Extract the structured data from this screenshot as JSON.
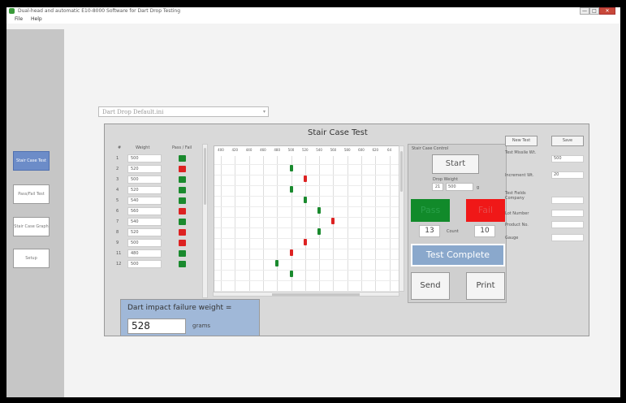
{
  "window": {
    "title": "Dual-head and automatic E10-8000 Software for Dart Drop Testing",
    "controls": {
      "minimize": "—",
      "maximize": "□",
      "close": "✕"
    }
  },
  "menu": [
    "File",
    "Help"
  ],
  "sidebar": {
    "items": [
      {
        "label": "Stair Case Test",
        "active": true
      },
      {
        "label": "Pass/Fail Test",
        "active": false
      },
      {
        "label": "Stair Case Graph",
        "active": false
      },
      {
        "label": "Setup",
        "active": false
      }
    ]
  },
  "profile_select": {
    "value": "Dart Drop Default.ini",
    "arrow": "▾"
  },
  "panel": {
    "title": "Stair Case Test"
  },
  "table": {
    "headers": {
      "num": "#",
      "weight": "Weight",
      "pf": "Pass / Fail"
    },
    "rows": [
      {
        "num": "1",
        "weight": "500",
        "pass": true
      },
      {
        "num": "2",
        "weight": "520",
        "pass": false
      },
      {
        "num": "3",
        "weight": "500",
        "pass": true
      },
      {
        "num": "4",
        "weight": "520",
        "pass": true
      },
      {
        "num": "5",
        "weight": "540",
        "pass": true
      },
      {
        "num": "6",
        "weight": "560",
        "pass": false
      },
      {
        "num": "7",
        "weight": "540",
        "pass": true
      },
      {
        "num": "8",
        "weight": "520",
        "pass": false
      },
      {
        "num": "9",
        "weight": "500",
        "pass": false
      },
      {
        "num": "11",
        "weight": "480",
        "pass": true
      },
      {
        "num": "12",
        "weight": "500",
        "pass": true
      }
    ]
  },
  "chart_data": {
    "type": "scatter",
    "x_ticks": [
      "400",
      "420",
      "440",
      "460",
      "480",
      "500",
      "520",
      "540",
      "560",
      "580",
      "600",
      "620",
      "64"
    ],
    "xlim": [
      400,
      640
    ],
    "points": [
      {
        "x": 500,
        "row": 1,
        "pass": true
      },
      {
        "x": 520,
        "row": 2,
        "pass": false
      },
      {
        "x": 500,
        "row": 3,
        "pass": true
      },
      {
        "x": 520,
        "row": 4,
        "pass": true
      },
      {
        "x": 540,
        "row": 5,
        "pass": true
      },
      {
        "x": 560,
        "row": 6,
        "pass": false
      },
      {
        "x": 540,
        "row": 7,
        "pass": true
      },
      {
        "x": 520,
        "row": 8,
        "pass": false
      },
      {
        "x": 500,
        "row": 9,
        "pass": false
      },
      {
        "x": 480,
        "row": 10,
        "pass": true
      },
      {
        "x": 500,
        "row": 11,
        "pass": true
      }
    ]
  },
  "controls": {
    "label": "Stair Case Control",
    "start": "Start",
    "drop_weight_label": "Drop Weight",
    "drop_weight_a": "21",
    "drop_weight_b": "500",
    "unit": "g",
    "pass": "Pass",
    "fail": "Fail",
    "pass_count": "13",
    "count_label": "Count",
    "fail_count": "10",
    "status": "Test Complete",
    "send": "Send",
    "print": "Print"
  },
  "right_panel": {
    "new_test": "New Test",
    "save": "Save",
    "fields": [
      {
        "label": "Test Missile Wt.",
        "value": "500"
      },
      {
        "label": "Increment Wt.",
        "value": "20"
      },
      {
        "label": "Test Fields Company",
        "value": ""
      },
      {
        "label": "Lot Number",
        "value": ""
      },
      {
        "label": "Product No.",
        "value": ""
      },
      {
        "label": "Gauge",
        "value": ""
      }
    ]
  },
  "result": {
    "label": "Dart impact failure weight =",
    "value": "528",
    "unit": "grams"
  },
  "colors": {
    "pass": "#1a8a2e",
    "fail": "#dd2222",
    "accent": "#6c8cc8"
  }
}
